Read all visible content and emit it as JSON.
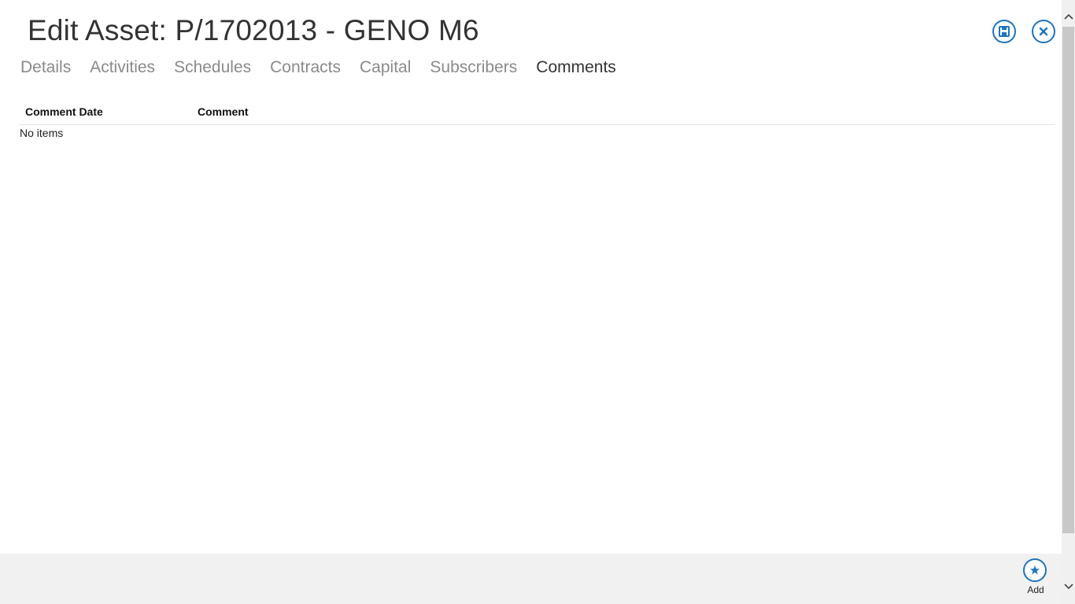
{
  "header": {
    "title": "Edit Asset: P/1702013 - GENO M6",
    "save_icon": "save-icon",
    "close_icon": "close-icon"
  },
  "tabs": [
    {
      "label": "Details",
      "active": false
    },
    {
      "label": "Activities",
      "active": false
    },
    {
      "label": "Schedules",
      "active": false
    },
    {
      "label": "Contracts",
      "active": false
    },
    {
      "label": "Capital",
      "active": false
    },
    {
      "label": "Subscribers",
      "active": false
    },
    {
      "label": "Comments",
      "active": true
    }
  ],
  "table": {
    "columns": [
      "Comment Date",
      "Comment"
    ],
    "rows": [],
    "empty_text": "No items"
  },
  "footer": {
    "add_label": "Add",
    "add_icon": "star-icon"
  },
  "colors": {
    "accent": "#1e73be",
    "tab_inactive": "#8a8a8a",
    "tab_active": "#333333",
    "footer_bg": "#f1f1f1"
  }
}
